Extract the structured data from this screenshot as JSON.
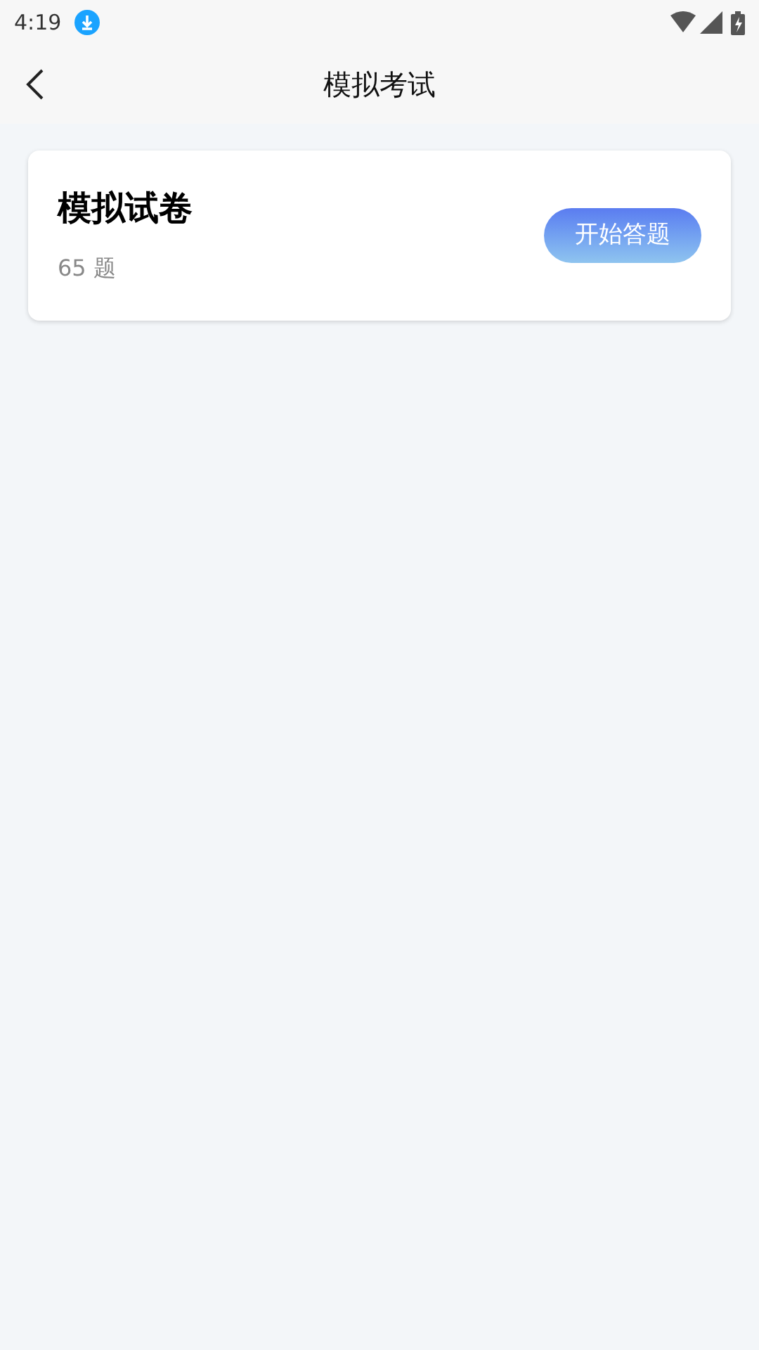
{
  "status_bar": {
    "time": "4:19"
  },
  "header": {
    "title": "模拟考试"
  },
  "papers": [
    {
      "title": "模拟试卷",
      "count": "65 题",
      "button": "开始答题"
    }
  ]
}
